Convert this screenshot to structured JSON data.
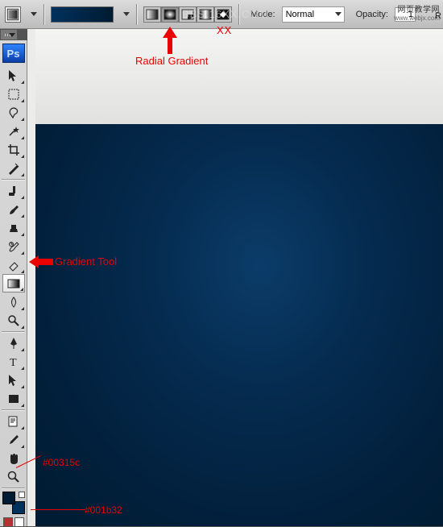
{
  "options": {
    "mode_label": "Mode:",
    "mode_value": "Normal",
    "opacity_label": "Opacity:",
    "opacity_value": "1",
    "tail": "R"
  },
  "watermark": {
    "cn": "网页教学网",
    "en": "www.webjx.com",
    "center": "BBS.16XX.COM"
  },
  "annotations": {
    "radial": "Radial Gradient",
    "xx": "XX",
    "gradient_tool": "Gradient Tool",
    "hex_fg": "#00315c",
    "hex_bg": "#001b32"
  },
  "logo": "Ps",
  "colors": {
    "fg": "#001b32",
    "bg": "#00315c"
  },
  "chart_data": null
}
